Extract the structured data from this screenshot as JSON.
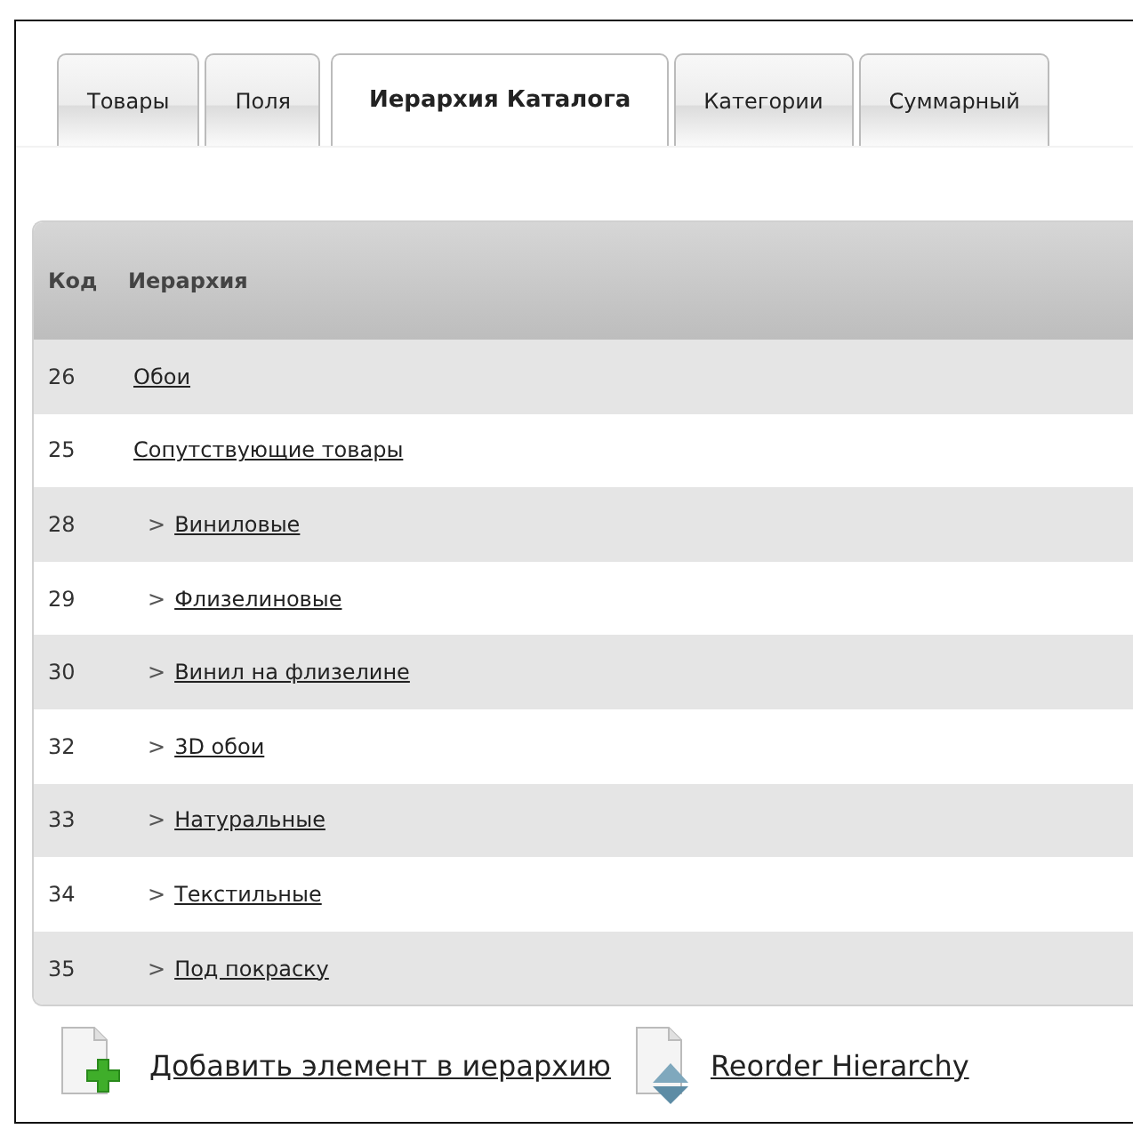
{
  "tabs": [
    {
      "label": "Товары",
      "selected": false
    },
    {
      "label": "Поля",
      "selected": false
    },
    {
      "label": "Иерархия Каталога",
      "selected": true
    },
    {
      "label": "Категории",
      "selected": false
    },
    {
      "label": "Суммарный",
      "selected": false
    }
  ],
  "table": {
    "columns": [
      "Код",
      "Иерархия"
    ],
    "rows": [
      {
        "code": "26",
        "name": "Обои"
      },
      {
        "code": "25",
        "name": "Сопутствующие товары",
        "children": [
          {
            "code": "28",
            "marker": ">",
            "name": "Виниловые"
          },
          {
            "code": "29",
            "marker": ">",
            "name": "Флизелиновые"
          },
          {
            "code": "30",
            "marker": ">",
            "name": "Винил на флизелине"
          },
          {
            "code": "32",
            "marker": ">",
            "name": "3D обои"
          },
          {
            "code": "33",
            "marker": ">",
            "name": "Натуральные"
          },
          {
            "code": "34",
            "marker": ">",
            "name": "Текстильные"
          },
          {
            "code": "35",
            "marker": ">",
            "name": "Под покраску"
          }
        ]
      }
    ]
  },
  "actions": [
    {
      "kind": "add",
      "label": "Добавить элемент в иерархию"
    },
    {
      "kind": "reorder",
      "label": "Reorder Hierarchy"
    }
  ]
}
